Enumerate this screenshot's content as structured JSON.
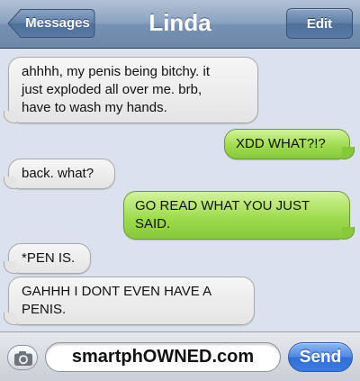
{
  "header": {
    "back_label": "Messages",
    "title": "Linda",
    "edit_label": "Edit"
  },
  "messages": [
    {
      "direction": "received",
      "lines": [
        "ahhhh, my penis being bitchy. it",
        "just exploded all over me. brb,",
        "have to wash my hands."
      ]
    },
    {
      "direction": "sent",
      "text": "XDD WHAT?!?"
    },
    {
      "direction": "received",
      "text": "back. what?"
    },
    {
      "direction": "sent",
      "lines": [
        "GO READ WHAT YOU JUST",
        "SAID."
      ]
    },
    {
      "direction": "received",
      "text": "*PEN IS."
    },
    {
      "direction": "received",
      "lines": [
        "GAHHH I DONT EVEN HAVE  A",
        "PENIS."
      ]
    }
  ],
  "compose": {
    "camera_icon": "camera-icon",
    "field_text": "smartphOWNED.com",
    "send_label": "Send"
  },
  "colors": {
    "received_bubble": "#e4e4e4",
    "sent_bubble": "#9fdc4e",
    "background": "#dbe2ed",
    "send_button": "#3b7ae0"
  }
}
